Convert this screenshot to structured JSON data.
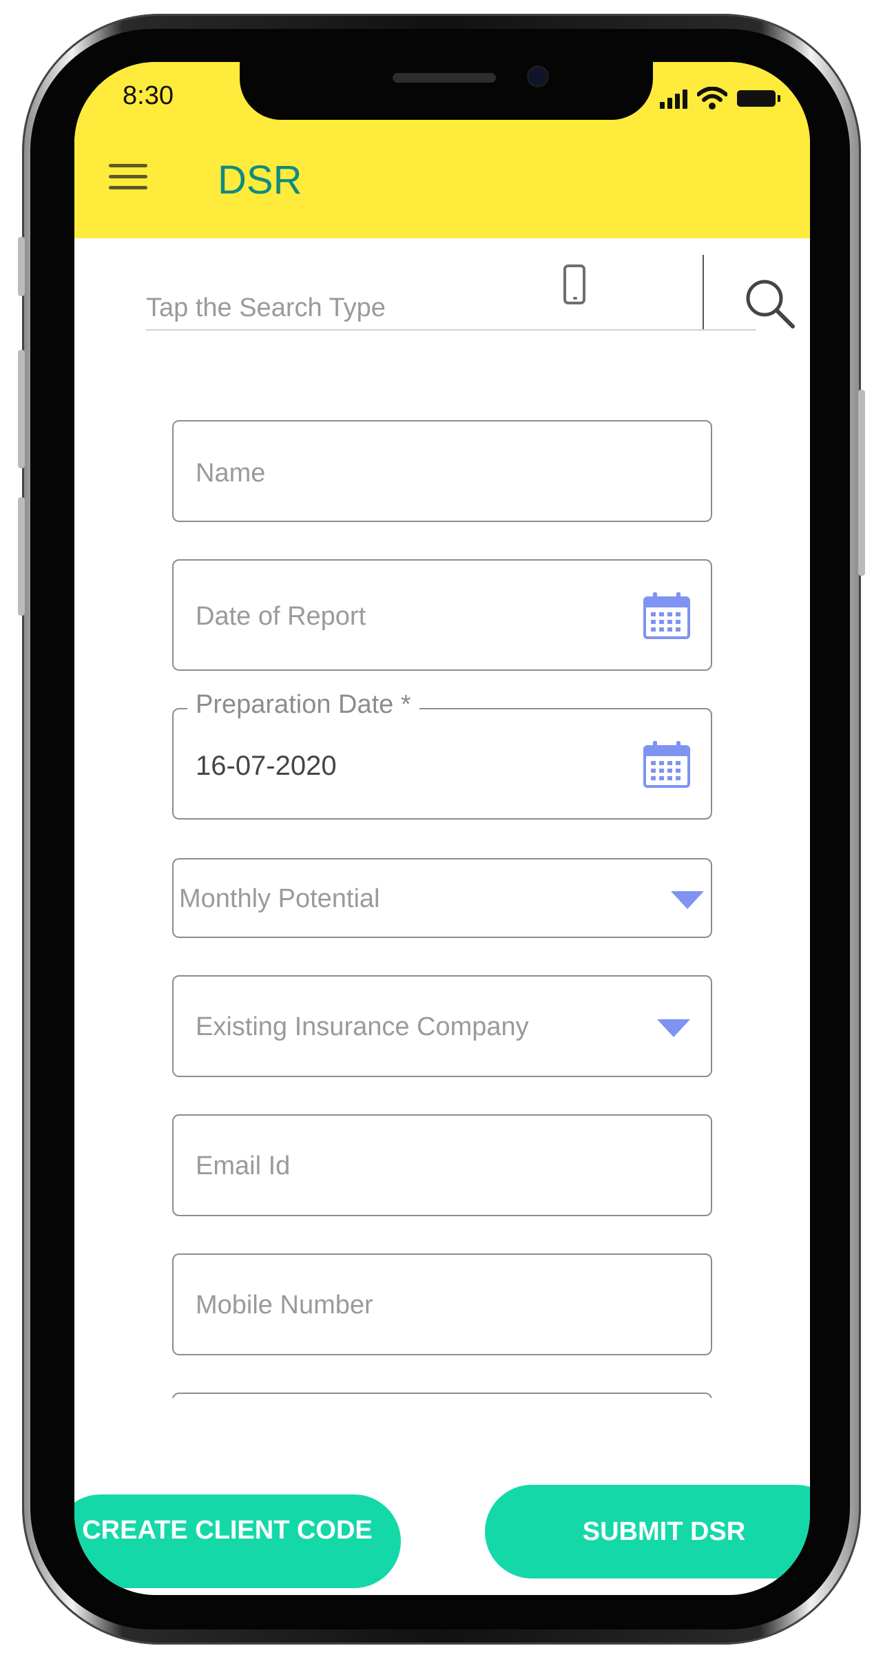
{
  "status_bar": {
    "time": "8:30"
  },
  "header": {
    "title": "DSR",
    "menu_icon": "hamburger-menu-icon"
  },
  "search": {
    "placeholder": "Tap the Search Type",
    "type_icon": "mobile-phone-icon",
    "search_icon": "search-icon"
  },
  "form": {
    "name_placeholder": "Name",
    "date_of_report_placeholder": "Date of Report",
    "preparation_date_label": "Preparation Date *",
    "preparation_date_value": "16-07-2020",
    "monthly_potential_placeholder": "Monthly Potential",
    "existing_insurance_placeholder": "Existing Insurance Company",
    "email_placeholder": "Email Id",
    "mobile_placeholder": "Mobile Number"
  },
  "buttons": {
    "create_client_code": "CREATE CLIENT CODE",
    "submit_dsr": "SUBMIT DSR"
  },
  "colors": {
    "app_bar": "#ffeb3b",
    "title": "#108b7f",
    "button": "#15d8a9",
    "icon_accent": "#7f93f3"
  }
}
